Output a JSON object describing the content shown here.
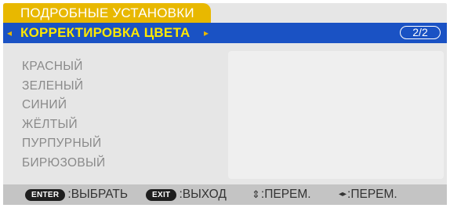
{
  "menu": {
    "tab_label": "ПОДРОБНЫЕ УСТАНОВКИ",
    "submenu_title": "КОРРЕКТИРОВКА ЦВЕТА",
    "page_indicator": "2/2",
    "left_arrow": "◂",
    "right_arrow": "▸"
  },
  "items": [
    {
      "label": "КРАСНЫЙ"
    },
    {
      "label": "ЗЕЛЕНЫЙ"
    },
    {
      "label": "СИНИЙ"
    },
    {
      "label": "ЖЁЛТЫЙ"
    },
    {
      "label": "ПУРПУРНЫЙ"
    },
    {
      "label": "БИРЮЗОВЫЙ"
    }
  ],
  "help": {
    "enter_key": "ENTER",
    "enter_action": ":ВЫБРАТЬ",
    "exit_key": "EXIT",
    "exit_action": ":ВЫХОД",
    "updown_glyph": "⇕",
    "updown_action": ":ПЕРЕМ.",
    "leftright_glyph": "◂▸",
    "leftright_action": ":ПЕРЕМ."
  },
  "colors": {
    "tab_active": "#e8b800",
    "subbar": "#1a52c4",
    "subtitle_text": "#ffe800",
    "panel": "#e6e6e6",
    "item_text": "#8a8a8a",
    "helpbar": "#c4c4c4"
  }
}
